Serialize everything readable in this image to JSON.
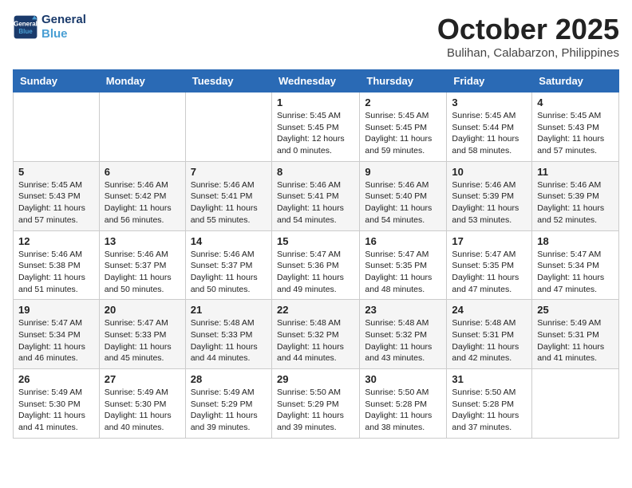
{
  "logo": {
    "line1": "General",
    "line2": "Blue"
  },
  "title": "October 2025",
  "location": "Bulihan, Calabarzon, Philippines",
  "weekdays": [
    "Sunday",
    "Monday",
    "Tuesday",
    "Wednesday",
    "Thursday",
    "Friday",
    "Saturday"
  ],
  "weeks": [
    [
      {
        "day": "",
        "info": ""
      },
      {
        "day": "",
        "info": ""
      },
      {
        "day": "",
        "info": ""
      },
      {
        "day": "1",
        "info": "Sunrise: 5:45 AM\nSunset: 5:45 PM\nDaylight: 12 hours\nand 0 minutes."
      },
      {
        "day": "2",
        "info": "Sunrise: 5:45 AM\nSunset: 5:45 PM\nDaylight: 11 hours\nand 59 minutes."
      },
      {
        "day": "3",
        "info": "Sunrise: 5:45 AM\nSunset: 5:44 PM\nDaylight: 11 hours\nand 58 minutes."
      },
      {
        "day": "4",
        "info": "Sunrise: 5:45 AM\nSunset: 5:43 PM\nDaylight: 11 hours\nand 57 minutes."
      }
    ],
    [
      {
        "day": "5",
        "info": "Sunrise: 5:45 AM\nSunset: 5:43 PM\nDaylight: 11 hours\nand 57 minutes."
      },
      {
        "day": "6",
        "info": "Sunrise: 5:46 AM\nSunset: 5:42 PM\nDaylight: 11 hours\nand 56 minutes."
      },
      {
        "day": "7",
        "info": "Sunrise: 5:46 AM\nSunset: 5:41 PM\nDaylight: 11 hours\nand 55 minutes."
      },
      {
        "day": "8",
        "info": "Sunrise: 5:46 AM\nSunset: 5:41 PM\nDaylight: 11 hours\nand 54 minutes."
      },
      {
        "day": "9",
        "info": "Sunrise: 5:46 AM\nSunset: 5:40 PM\nDaylight: 11 hours\nand 54 minutes."
      },
      {
        "day": "10",
        "info": "Sunrise: 5:46 AM\nSunset: 5:39 PM\nDaylight: 11 hours\nand 53 minutes."
      },
      {
        "day": "11",
        "info": "Sunrise: 5:46 AM\nSunset: 5:39 PM\nDaylight: 11 hours\nand 52 minutes."
      }
    ],
    [
      {
        "day": "12",
        "info": "Sunrise: 5:46 AM\nSunset: 5:38 PM\nDaylight: 11 hours\nand 51 minutes."
      },
      {
        "day": "13",
        "info": "Sunrise: 5:46 AM\nSunset: 5:37 PM\nDaylight: 11 hours\nand 50 minutes."
      },
      {
        "day": "14",
        "info": "Sunrise: 5:46 AM\nSunset: 5:37 PM\nDaylight: 11 hours\nand 50 minutes."
      },
      {
        "day": "15",
        "info": "Sunrise: 5:47 AM\nSunset: 5:36 PM\nDaylight: 11 hours\nand 49 minutes."
      },
      {
        "day": "16",
        "info": "Sunrise: 5:47 AM\nSunset: 5:35 PM\nDaylight: 11 hours\nand 48 minutes."
      },
      {
        "day": "17",
        "info": "Sunrise: 5:47 AM\nSunset: 5:35 PM\nDaylight: 11 hours\nand 47 minutes."
      },
      {
        "day": "18",
        "info": "Sunrise: 5:47 AM\nSunset: 5:34 PM\nDaylight: 11 hours\nand 47 minutes."
      }
    ],
    [
      {
        "day": "19",
        "info": "Sunrise: 5:47 AM\nSunset: 5:34 PM\nDaylight: 11 hours\nand 46 minutes."
      },
      {
        "day": "20",
        "info": "Sunrise: 5:47 AM\nSunset: 5:33 PM\nDaylight: 11 hours\nand 45 minutes."
      },
      {
        "day": "21",
        "info": "Sunrise: 5:48 AM\nSunset: 5:33 PM\nDaylight: 11 hours\nand 44 minutes."
      },
      {
        "day": "22",
        "info": "Sunrise: 5:48 AM\nSunset: 5:32 PM\nDaylight: 11 hours\nand 44 minutes."
      },
      {
        "day": "23",
        "info": "Sunrise: 5:48 AM\nSunset: 5:32 PM\nDaylight: 11 hours\nand 43 minutes."
      },
      {
        "day": "24",
        "info": "Sunrise: 5:48 AM\nSunset: 5:31 PM\nDaylight: 11 hours\nand 42 minutes."
      },
      {
        "day": "25",
        "info": "Sunrise: 5:49 AM\nSunset: 5:31 PM\nDaylight: 11 hours\nand 41 minutes."
      }
    ],
    [
      {
        "day": "26",
        "info": "Sunrise: 5:49 AM\nSunset: 5:30 PM\nDaylight: 11 hours\nand 41 minutes."
      },
      {
        "day": "27",
        "info": "Sunrise: 5:49 AM\nSunset: 5:30 PM\nDaylight: 11 hours\nand 40 minutes."
      },
      {
        "day": "28",
        "info": "Sunrise: 5:49 AM\nSunset: 5:29 PM\nDaylight: 11 hours\nand 39 minutes."
      },
      {
        "day": "29",
        "info": "Sunrise: 5:50 AM\nSunset: 5:29 PM\nDaylight: 11 hours\nand 39 minutes."
      },
      {
        "day": "30",
        "info": "Sunrise: 5:50 AM\nSunset: 5:28 PM\nDaylight: 11 hours\nand 38 minutes."
      },
      {
        "day": "31",
        "info": "Sunrise: 5:50 AM\nSunset: 5:28 PM\nDaylight: 11 hours\nand 37 minutes."
      },
      {
        "day": "",
        "info": ""
      }
    ]
  ]
}
